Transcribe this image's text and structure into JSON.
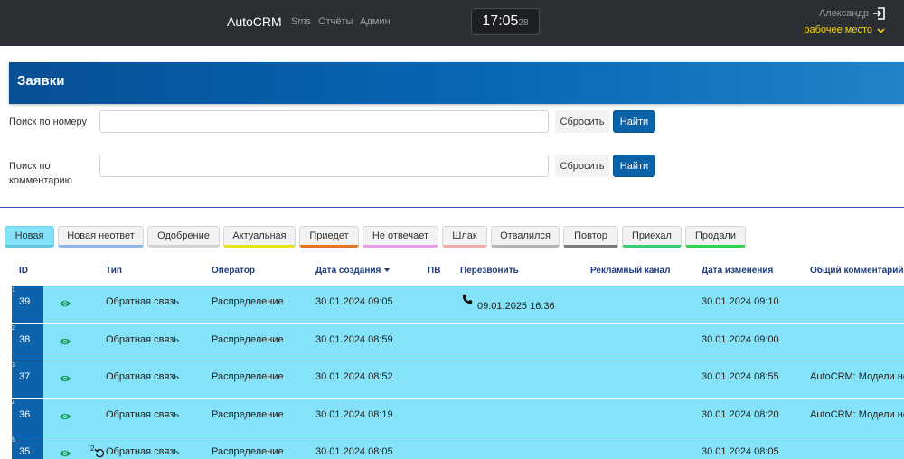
{
  "navbar": {
    "brand": "AutoCRM",
    "links": [
      "Sms",
      "Отчёты",
      "Админ"
    ],
    "clock": {
      "hm": "17:05",
      "sec": "28"
    },
    "user": "Александр",
    "workplace": "рабочее место"
  },
  "page": {
    "title": "Заявки"
  },
  "search": {
    "by_number_label": "Поиск по номеру",
    "by_comment_label": "Поиск по комментарию",
    "number_value": "",
    "comment_value": "",
    "reset_label": "Сбросить",
    "find_label": "Найти"
  },
  "tabs": [
    {
      "label": "Новая",
      "color": "#5fc6e2"
    },
    {
      "label": "Новая неответ",
      "color": "#8fb5ee"
    },
    {
      "label": "Одобрение",
      "color": "#d3d3d3"
    },
    {
      "label": "Актуальная",
      "color": "#e6e21c"
    },
    {
      "label": "Приедет",
      "color": "#e8761e"
    },
    {
      "label": "Не отвечает",
      "color": "#e79be9"
    },
    {
      "label": "Шлак",
      "color": "#f3a9a9"
    },
    {
      "label": "Отвалился",
      "color": "#b5b5b5"
    },
    {
      "label": "Повтор",
      "color": "#7a7a7a"
    },
    {
      "label": "Приехал",
      "color": "#37cf73"
    },
    {
      "label": "Продали",
      "color": "#2fd84a"
    }
  ],
  "table": {
    "headers": {
      "id": "ID",
      "type": "Тип",
      "operator": "Оператор",
      "created": "Дата создания",
      "pv": "ПВ",
      "callback": "Перезвонить",
      "ad_channel": "Рекламный канал",
      "modified": "Дата изменения",
      "comment": "Общий комментарий"
    },
    "rows": [
      {
        "num": "1",
        "id": "39",
        "type": "Обратная связь",
        "operator": "Распределение",
        "created": "30.01.2024 09:05",
        "callback": "09.01.2025 16:36",
        "modified": "30.01.2024 09:10",
        "comment": "",
        "badge": ""
      },
      {
        "num": "2",
        "id": "38",
        "type": "Обратная связь",
        "operator": "Распределение",
        "created": "30.01.2024 08:59",
        "callback": "",
        "modified": "30.01.2024 09:00",
        "comment": "",
        "badge": ""
      },
      {
        "num": "3",
        "id": "37",
        "type": "Обратная связь",
        "operator": "Распределение",
        "created": "30.01.2024 08:52",
        "callback": "",
        "modified": "30.01.2024 08:55",
        "comment": "AutoCRM: Модели не",
        "badge": ""
      },
      {
        "num": "4",
        "id": "36",
        "type": "Обратная связь",
        "operator": "Распределение",
        "created": "30.01.2024 08:19",
        "callback": "",
        "modified": "30.01.2024 08:20",
        "comment": "AutoCRM: Модели не",
        "badge": ""
      },
      {
        "num": "5",
        "id": "35",
        "type": "Обратная связь",
        "operator": "Распределение",
        "created": "30.01.2024 08:05",
        "callback": "",
        "modified": "30.01.2024 08:05",
        "comment": "",
        "badge": "2"
      }
    ]
  },
  "colors": {
    "row_bg": "#84e3f9",
    "id_bg": "#0d63ab",
    "eye": "#1a9a55",
    "header": "#0768b8",
    "find": "#0a63a8"
  }
}
